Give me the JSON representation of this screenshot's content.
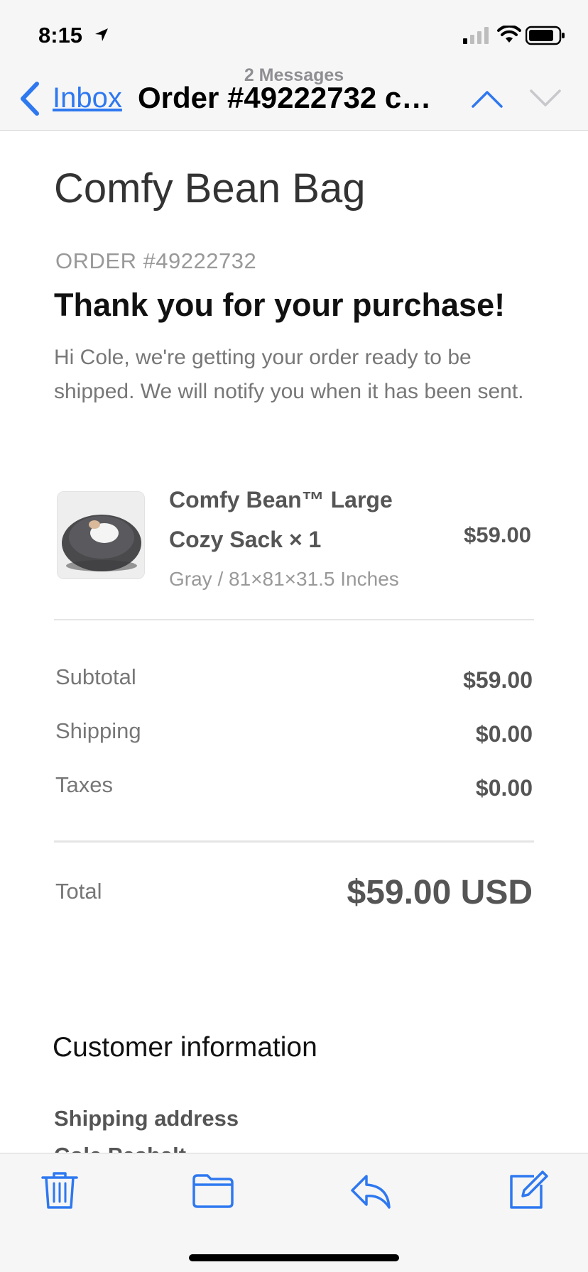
{
  "status_bar": {
    "time": "8:15",
    "icons": [
      "location-arrow-icon",
      "cellular-signal-icon",
      "wifi-icon",
      "battery-icon"
    ]
  },
  "nav": {
    "back_label": "Inbox",
    "subtitle": "2 Messages",
    "title": "Order #49222732 c…",
    "icons": [
      "chevron-left-icon",
      "chevron-up-icon",
      "chevron-down-icon"
    ]
  },
  "email": {
    "shop_name": "Comfy Bean Bag",
    "order_number": "ORDER #49222732",
    "heading": "Thank you for your purchase!",
    "intro": "Hi Cole, we're getting your order ready to be shipped. We will notify you when it has been sent.",
    "product": {
      "name": "Comfy Bean™ Large Cozy Sack × 1",
      "variant": "Gray / 81×81×31.5 Inches",
      "price": "$59.00"
    },
    "summary": {
      "subtotal_label": "Subtotal",
      "subtotal_value": "$59.00",
      "shipping_label": "Shipping",
      "shipping_value": "$0.00",
      "taxes_label": "Taxes",
      "taxes_value": "$0.00",
      "total_label": "Total",
      "total_value": "$59.00 USD"
    },
    "customer_info_heading": "Customer information",
    "shipping_address_heading": "Shipping address",
    "shipping_address_first_line": "Cole Peshalt"
  },
  "toolbar": {
    "icons": [
      "trash-icon",
      "folder-icon",
      "reply-icon",
      "compose-icon"
    ]
  },
  "colors": {
    "accent": "#2e78f0",
    "text_dark": "#111111",
    "text_muted": "#777777",
    "chrome_bg": "#f6f6f6"
  }
}
